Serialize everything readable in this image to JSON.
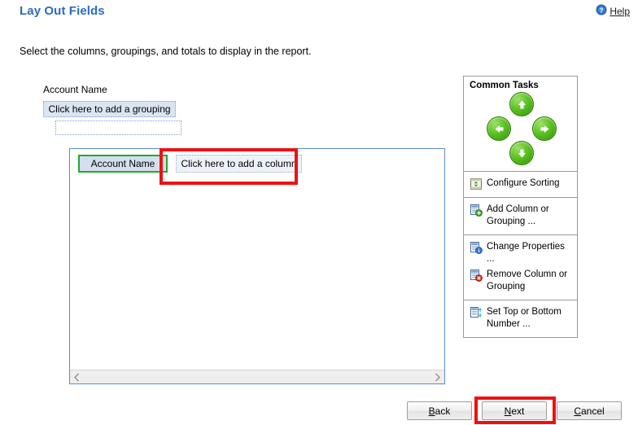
{
  "header": {
    "title": "Lay Out Fields",
    "help_label": "Help",
    "help_icon": "help-circle-icon"
  },
  "instruction": "Select the columns, groupings, and totals to display in the report.",
  "grouping": {
    "label": "Account Name",
    "add_grouping_text": "Click here to add a grouping",
    "empty_placeholder_text": ""
  },
  "report_panel": {
    "column_header": "Account Name",
    "add_column_text": "Click here to add a column",
    "scroll_left_icon": "chevron-left-icon",
    "scroll_right_icon": "chevron-right-icon"
  },
  "common_tasks": {
    "title": "Common Tasks",
    "arrows": [
      {
        "name": "move-up",
        "icon": "arrow-up-icon",
        "glyph": "▲"
      },
      {
        "name": "move-left",
        "icon": "arrow-left-icon",
        "glyph": "◀"
      },
      {
        "name": "move-right",
        "icon": "arrow-right-icon",
        "glyph": "▶"
      },
      {
        "name": "move-down",
        "icon": "arrow-down-icon",
        "glyph": "▼"
      }
    ],
    "groups": [
      {
        "items": [
          {
            "label": "Configure Sorting",
            "icon": "sort-icon"
          }
        ]
      },
      {
        "items": [
          {
            "label": "Add Column or Grouping ...",
            "icon": "add-column-icon"
          }
        ]
      },
      {
        "items": [
          {
            "label": "Change Properties ...",
            "icon": "properties-icon"
          },
          {
            "label": "Remove Column or Grouping",
            "icon": "remove-column-icon"
          }
        ]
      },
      {
        "items": [
          {
            "label": "Set Top or Bottom Number ...",
            "icon": "top-bottom-icon"
          }
        ]
      }
    ]
  },
  "buttons": {
    "back": {
      "prefix": "",
      "accel": "B",
      "suffix": "ack"
    },
    "next": {
      "prefix": "",
      "accel": "N",
      "suffix": "ext"
    },
    "cancel": {
      "prefix": "",
      "accel": "C",
      "suffix": "ancel"
    }
  },
  "colors": {
    "title_blue": "#2a6bc4",
    "panel_border_blue": "#5b8fd1",
    "highlight_red": "#ee1111",
    "selection_green": "#1faa2e",
    "arrow_green": "#5cc222"
  }
}
